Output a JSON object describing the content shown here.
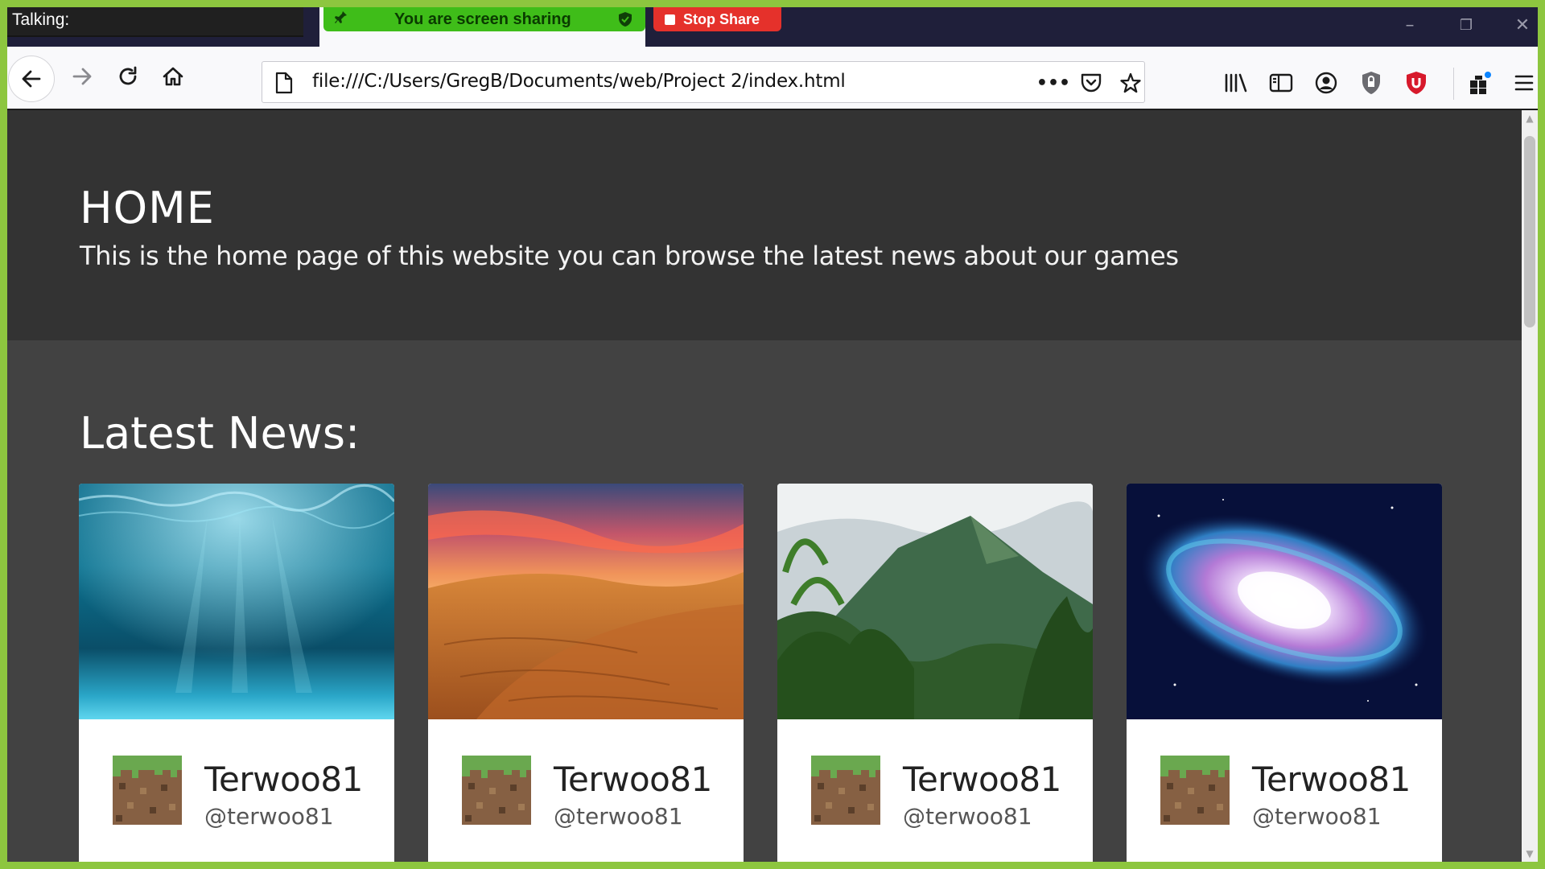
{
  "talking_label": "Talking:",
  "screen_share": {
    "banner_text": "You are screen sharing",
    "stop_label": "Stop Share",
    "banner_color": "#3fbd19",
    "stop_color": "#e5312b"
  },
  "browser": {
    "url": "file:///C:/Users/GregB/Documents/web/Project 2/index.html",
    "nav_icons": [
      "back-icon",
      "forward-icon",
      "reload-icon",
      "home-icon"
    ],
    "toolbar_icons": [
      "library-icon",
      "sidebar-icon",
      "account-icon",
      "shield-icon",
      "ublock-icon",
      "extensions-icon",
      "menu-icon"
    ]
  },
  "hero": {
    "title": "HOME",
    "subtitle": "This is the home page of this website you can browse the latest news about our games"
  },
  "news": {
    "heading": "Latest News:",
    "cards": [
      {
        "image": "underwater",
        "author": "Terwoo81",
        "handle": "@terwoo81"
      },
      {
        "image": "desert",
        "author": "Terwoo81",
        "handle": "@terwoo81"
      },
      {
        "image": "jungle-mountain",
        "author": "Terwoo81",
        "handle": "@terwoo81"
      },
      {
        "image": "galaxy",
        "author": "Terwoo81",
        "handle": "@terwoo81"
      }
    ]
  },
  "colors": {
    "frame": "#8dc63f",
    "hero_bg": "#333333",
    "page_bg": "#424242"
  }
}
